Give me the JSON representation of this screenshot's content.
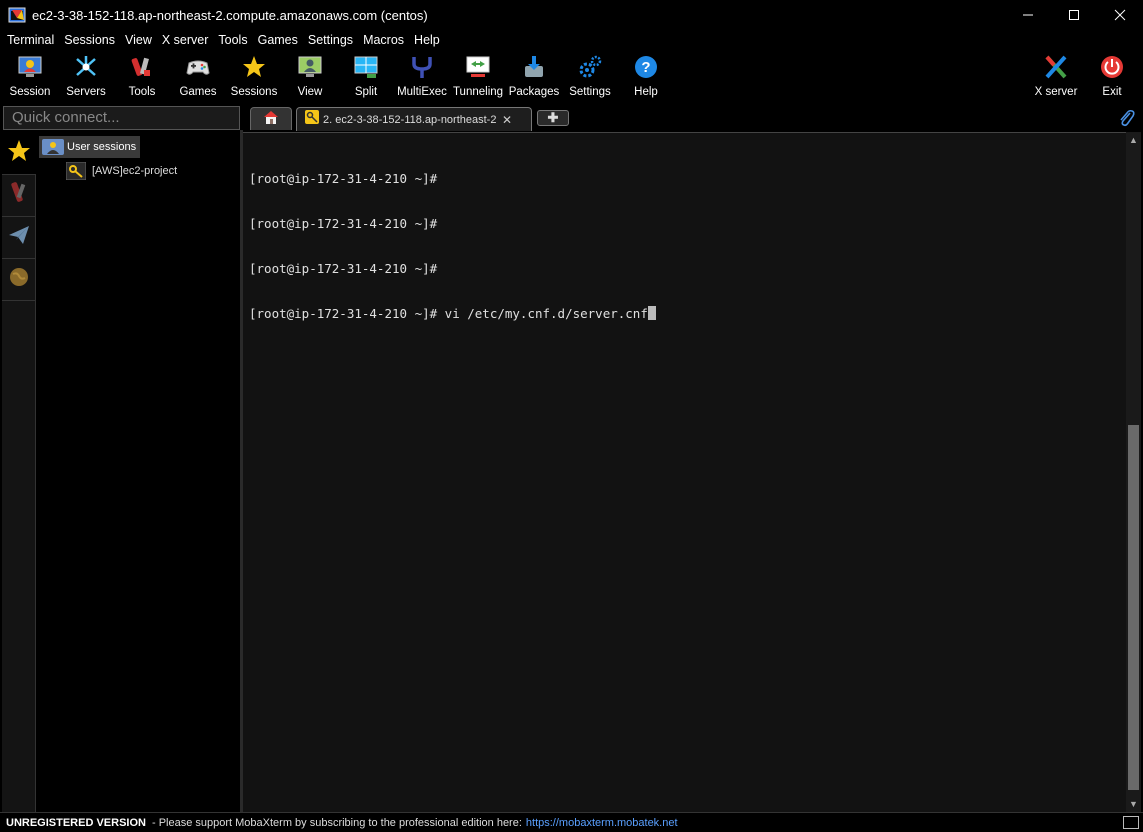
{
  "window": {
    "title": "ec2-3-38-152-118.ap-northeast-2.compute.amazonaws.com (centos)",
    "controls": {
      "minimize": "—",
      "maximize": "☐",
      "close": "✕"
    }
  },
  "menu": [
    "Terminal",
    "Sessions",
    "View",
    "X server",
    "Tools",
    "Games",
    "Settings",
    "Macros",
    "Help"
  ],
  "toolbar": {
    "session": "Session",
    "servers": "Servers",
    "tools": "Tools",
    "games": "Games",
    "sessions": "Sessions",
    "view": "View",
    "split": "Split",
    "multiexec": "MultiExec",
    "tunneling": "Tunneling",
    "packages": "Packages",
    "settings": "Settings",
    "help": "Help",
    "xserver": "X server",
    "exit": "Exit"
  },
  "quick_connect": {
    "placeholder": "Quick connect..."
  },
  "tabs": {
    "active_label": "2. ec2-3-38-152-118.ap-northeast-2",
    "close": "✕",
    "new": "✚"
  },
  "sessions_tree": {
    "root": "User sessions",
    "child": "[AWS]ec2-project"
  },
  "terminal": {
    "lines": [
      "[root@ip-172-31-4-210 ~]#",
      "[root@ip-172-31-4-210 ~]#",
      "[root@ip-172-31-4-210 ~]#",
      "[root@ip-172-31-4-210 ~]# vi /etc/my.cnf.d/server.cnf"
    ]
  },
  "status": {
    "unregistered": "UNREGISTERED VERSION",
    "message": "-  Please support MobaXterm by subscribing to the professional edition here:",
    "link": "https://mobaxterm.mobatek.net"
  },
  "colors": {
    "accent_link": "#5aa0ff",
    "exit_red": "#e53935",
    "star_yellow": "#f5c518"
  }
}
